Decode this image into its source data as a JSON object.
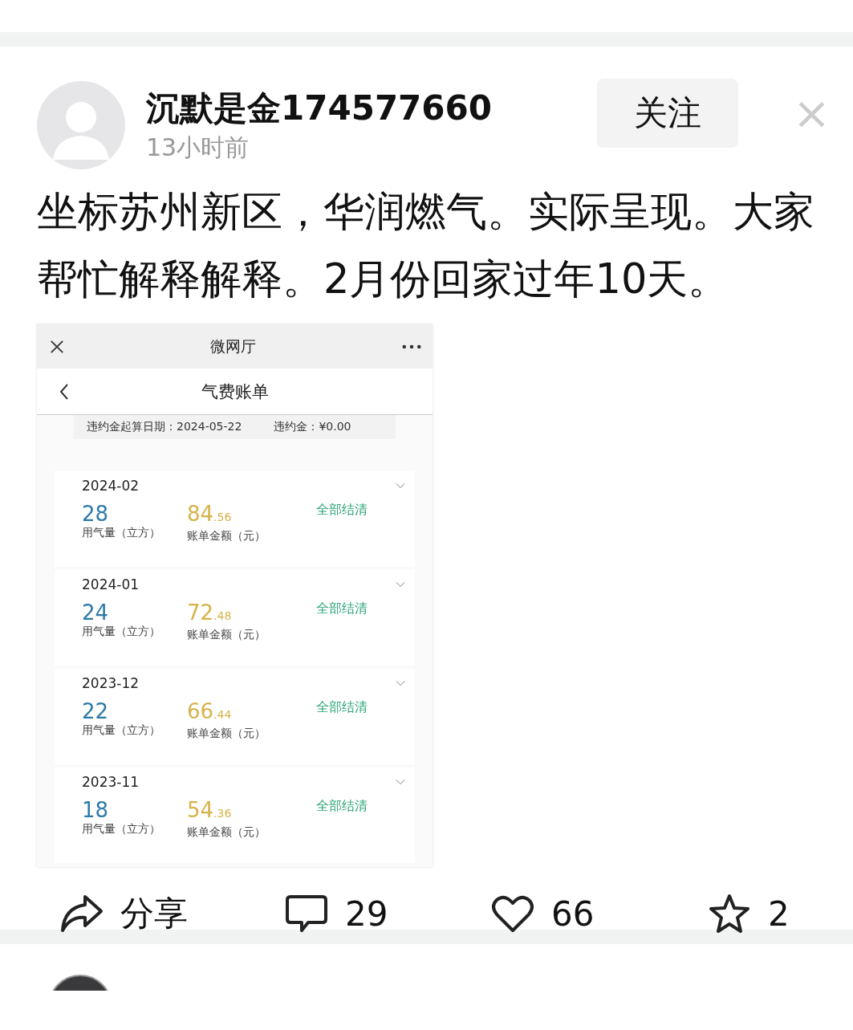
{
  "post": {
    "author": "沉默是金174577660",
    "time": "13小时前",
    "follow_button": "关注",
    "close_icon": "×",
    "text": "坐标苏州新区，华润燃气。实际呈现。大家帮忙解释解释。2月份回家过年10天。",
    "screenshot": {
      "window_title": "微网厅",
      "page_title": "气费账单",
      "penalty_date_label": "违约金起算日期：",
      "penalty_date": "2024-05-22",
      "penalty_label": "违约金：",
      "penalty_amount": "¥0.00",
      "bills": [
        {
          "month": "2024-02",
          "usage": "28",
          "usage_label": "用气量（立方）",
          "amount_integer": "84",
          "amount_decimal": ".56",
          "amount_label": "账单金额（元）",
          "status": "全部结清",
          "expanded": false
        },
        {
          "month": "2024-01",
          "usage": "24",
          "usage_label": "用气量（立方）",
          "amount_integer": "72",
          "amount_decimal": ".48",
          "amount_label": "账单金额（元）",
          "status": "全部结清",
          "expanded": false
        },
        {
          "month": "2023-12",
          "usage": "22",
          "usage_label": "用气量（立方）",
          "amount_integer": "66",
          "amount_decimal": ".44",
          "amount_label": "账单金额（元）",
          "status": "全部结清",
          "expanded": false
        },
        {
          "month": "2023-11",
          "usage": "18",
          "usage_label": "用气量（立方）",
          "amount_integer": "54",
          "amount_decimal": ".36",
          "amount_label": "账单金额（元）",
          "status": "全部结清",
          "expanded": false
        }
      ]
    },
    "actions": [
      {
        "kind": "share",
        "label": "分享"
      },
      {
        "kind": "comment",
        "label": "29"
      },
      {
        "kind": "like",
        "label": "66"
      },
      {
        "kind": "star",
        "label": "2"
      }
    ]
  }
}
